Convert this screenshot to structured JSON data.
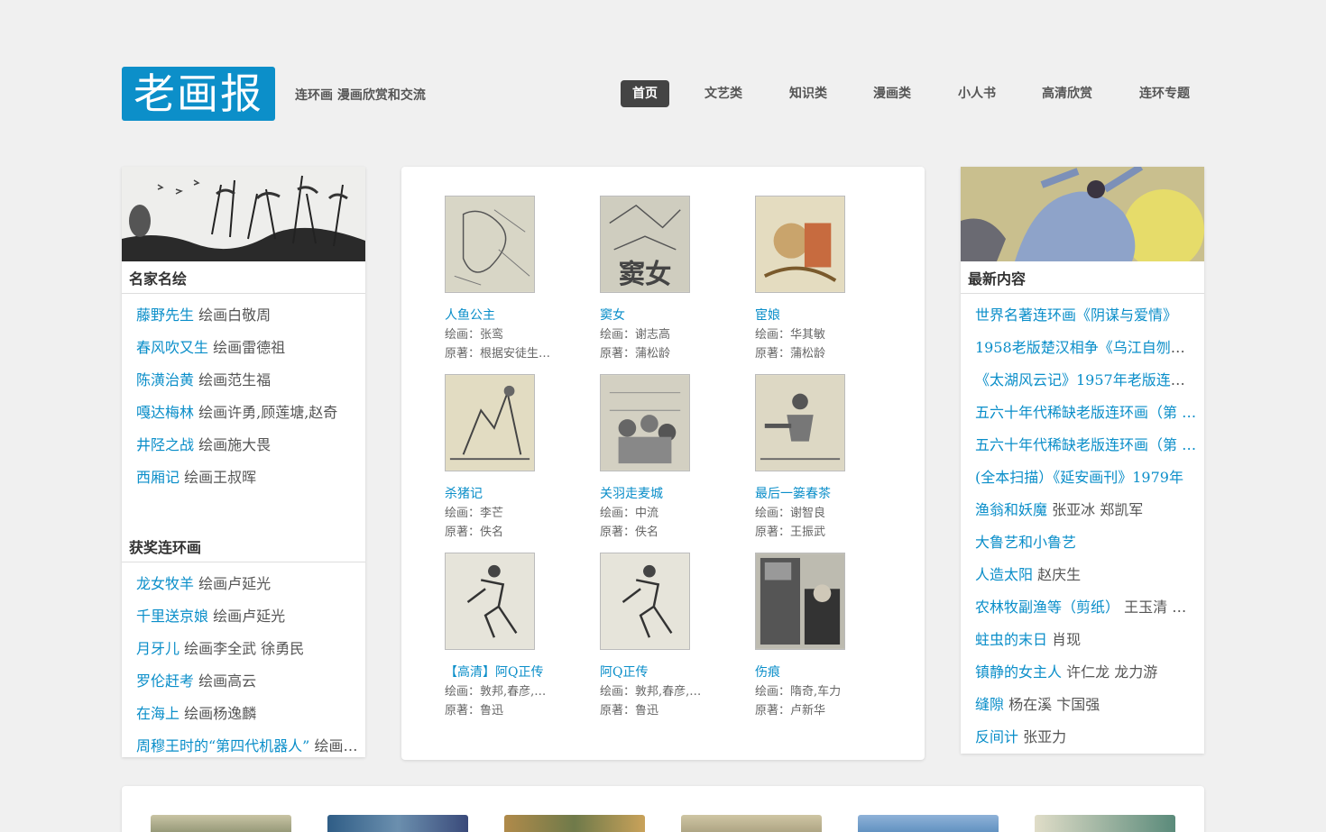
{
  "header": {
    "logo_text": "老画报",
    "tagline": "连环画 漫画欣赏和交流",
    "nav": [
      {
        "label": "首页",
        "active": true
      },
      {
        "label": "文艺类",
        "active": false
      },
      {
        "label": "知识类",
        "active": false
      },
      {
        "label": "漫画类",
        "active": false
      },
      {
        "label": "小人书",
        "active": false
      },
      {
        "label": "高清欣赏",
        "active": false
      },
      {
        "label": "连环专题",
        "active": false
      }
    ]
  },
  "left": {
    "famous_title": "名家名绘",
    "famous": [
      {
        "title": "藤野先生",
        "meta": "绘画白敬周"
      },
      {
        "title": "春风吹又生",
        "meta": "绘画雷德祖"
      },
      {
        "title": "陈潢治黄",
        "meta": "绘画范生福"
      },
      {
        "title": "嘎达梅林",
        "meta": "绘画许勇,顾莲塘,赵奇"
      },
      {
        "title": "井陉之战",
        "meta": "绘画施大畏"
      },
      {
        "title": "西厢记",
        "meta": "绘画王叔晖"
      }
    ],
    "award_title": "获奖连环画",
    "award": [
      {
        "title": "龙女牧羊",
        "meta": "绘画卢延光"
      },
      {
        "title": "千里送京娘",
        "meta": "绘画卢延光"
      },
      {
        "title": "月牙儿",
        "meta": "绘画李全武 徐勇民"
      },
      {
        "title": "罗伦赶考",
        "meta": "绘画高云"
      },
      {
        "title": "在海上",
        "meta": "绘画杨逸麟"
      },
      {
        "title": "周穆王时的“第四代机器人”",
        "meta": "绘画…"
      }
    ]
  },
  "center": {
    "cards": [
      {
        "title": "人鱼公主",
        "artist": "绘画：张鸾",
        "origin": "原著：根据安徒生…"
      },
      {
        "title": "窦女",
        "artist": "绘画：谢志高",
        "origin": "原著：蒲松龄"
      },
      {
        "title": "宦娘",
        "artist": "绘画：华其敏",
        "origin": "原著：蒲松龄"
      },
      {
        "title": "杀猪记",
        "artist": "绘画：李芒",
        "origin": "原著：佚名"
      },
      {
        "title": "关羽走麦城",
        "artist": "绘画：中流",
        "origin": "原著：佚名"
      },
      {
        "title": "最后一篓春茶",
        "artist": "绘画：谢智良",
        "origin": "原著：王振武"
      },
      {
        "title": "【高清】阿Q正传",
        "artist": "绘画：敦邦,春彦,…",
        "origin": "原著：鲁迅"
      },
      {
        "title": "阿Q正传",
        "artist": "绘画：敦邦,春彦,…",
        "origin": "原著：鲁迅"
      },
      {
        "title": "伤痕",
        "artist": "绘画：隋奇,车力",
        "origin": "原著：卢新华"
      }
    ]
  },
  "right": {
    "latest_title": "最新内容",
    "latest": [
      {
        "title": "世界名著连环画《阴谋与爱情》",
        "meta": ""
      },
      {
        "title": "1958老版楚汉相争《乌江自刎》李",
        "meta": ""
      },
      {
        "title": "《太湖风云记》1957年老版连环画",
        "meta": ""
      },
      {
        "title": "五六十年代稀缺老版连环画（第 …",
        "meta": ""
      },
      {
        "title": "五六十年代稀缺老版连环画（第 …",
        "meta": ""
      },
      {
        "title": "(全本扫描）《延安画刊》1979年",
        "meta": ""
      },
      {
        "title": "渔翁和妖魔",
        "meta": "张亚冰 郑凯军"
      },
      {
        "title": "大鲁艺和小鲁艺",
        "meta": ""
      },
      {
        "title": "人造太阳",
        "meta": "赵庆生"
      },
      {
        "title": "农林牧副渔等（剪纸）",
        "meta": "王玉清 …"
      },
      {
        "title": "蛀虫的末日",
        "meta": "肖现"
      },
      {
        "title": "镇静的女主人",
        "meta": "许仁龙 龙力游"
      },
      {
        "title": "缝隙",
        "meta": "杨在溪 卞国强"
      },
      {
        "title": "反间计",
        "meta": "张亚力"
      }
    ]
  },
  "colors": {
    "brand": "#0c8fc9",
    "link": "#0a8ec9",
    "nav_active": "#444444"
  }
}
